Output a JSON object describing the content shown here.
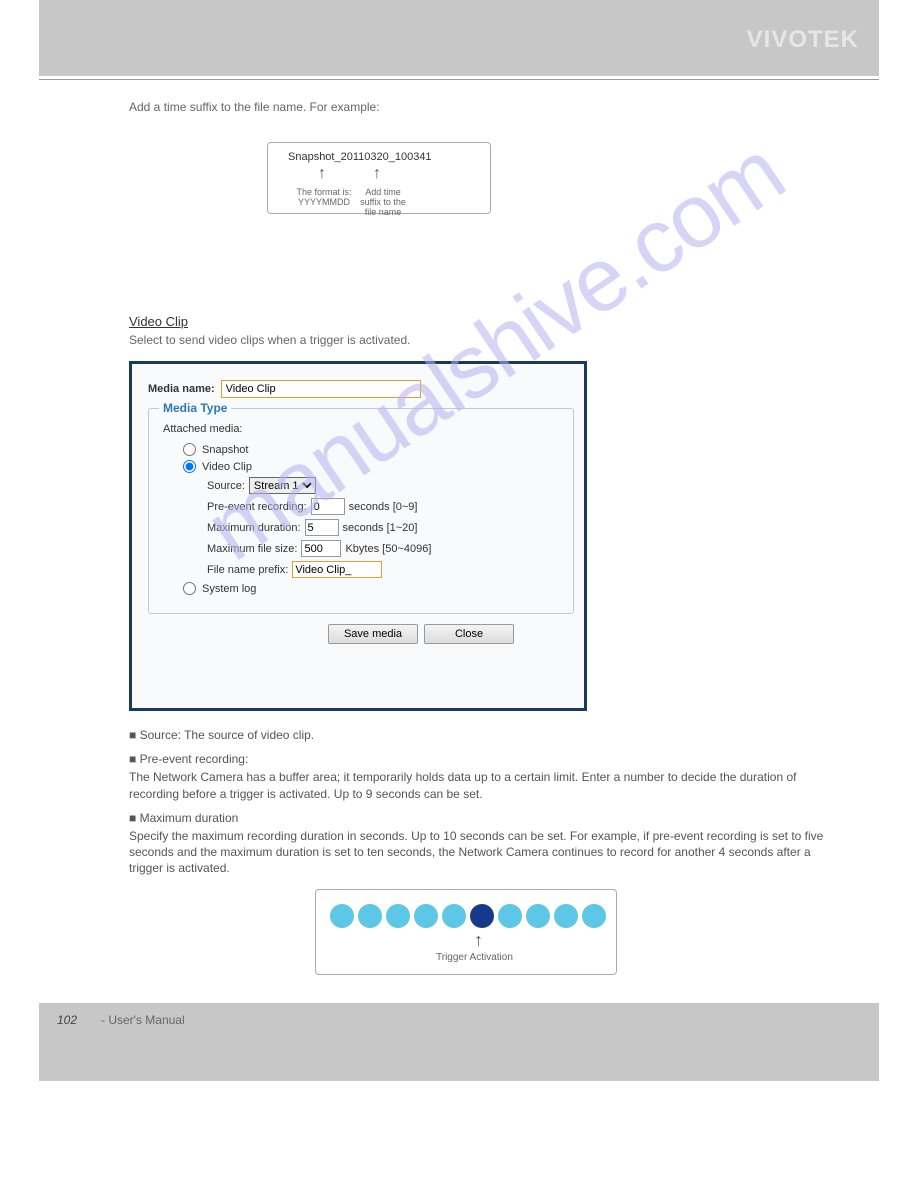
{
  "header": {
    "brand": "VIVOTEK"
  },
  "snapshot_box": {
    "filename": "Snapshot_20110320_100341",
    "caption_date": "The format is: YYYYMMDD",
    "caption_time": "Add time suffix to the file name"
  },
  "videoclip": {
    "heading": "Video Clip",
    "desc": "Select to send video clips when a trigger is activated."
  },
  "panel": {
    "media_name_label": "Media name:",
    "media_name_value": "Video Clip",
    "fieldset_title": "Media Type",
    "attached_label": "Attached media:",
    "options": {
      "snapshot": "Snapshot",
      "videoclip": "Video Clip",
      "systemlog": "System log"
    },
    "source_label": "Source:",
    "source_value": "Stream 1",
    "preevent_label": "Pre-event recording:",
    "preevent_value": "0",
    "preevent_hint": "seconds [0~9]",
    "maxdur_label": "Maximum duration:",
    "maxdur_value": "5",
    "maxdur_hint": "seconds [1~20]",
    "maxsize_label": "Maximum file size:",
    "maxsize_value": "500",
    "maxsize_hint": "Kbytes [50~4096]",
    "prefix_label": "File name prefix:",
    "prefix_value": "Video Clip_",
    "buttons": {
      "save": "Save media",
      "close": "Close"
    }
  },
  "bullets": {
    "source": "Source: The source of video clip.",
    "preevent_label": "Pre-event recording:",
    "preevent_text": "The Network Camera has a buffer area; it temporarily holds data up to a certain limit. Enter a number to decide the duration of recording before a trigger is activated. Up to 9 seconds can be set.",
    "maxdur_label": "Maximum duration",
    "maxdur_text": "Specify the maximum recording duration in seconds. Up to 10 seconds can be set. For example, if pre-event recording is set to five seconds and the maximum duration is set to ten seconds, the Network Camera continues to record for another 4 seconds after a trigger is activated."
  },
  "trigger_box": {
    "caption": "Trigger Activation"
  },
  "footer": {
    "page": "102",
    "title": "- User's Manual"
  },
  "watermark": "manualshive.com"
}
